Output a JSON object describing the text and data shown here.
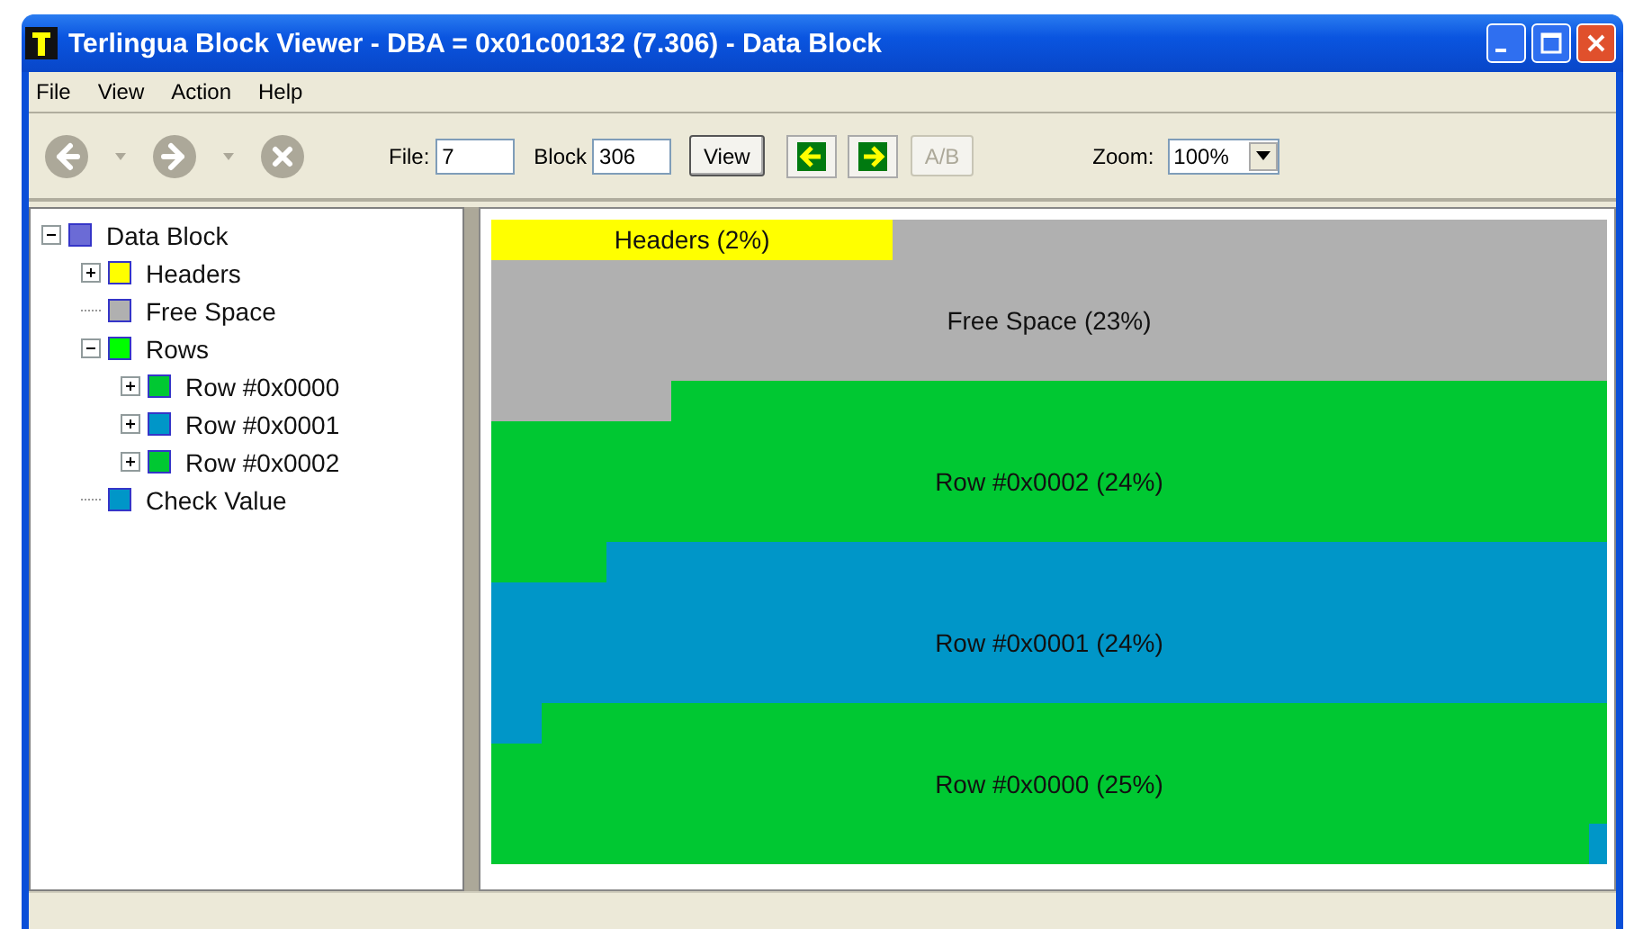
{
  "window": {
    "title": "Terlingua Block Viewer - DBA = 0x01c00132 (7.306) - Data Block"
  },
  "menu": [
    "File",
    "View",
    "Action",
    "Help"
  ],
  "toolbar": {
    "file_label": "File:",
    "file_value": "7",
    "block_label": "Block",
    "block_value": "306",
    "view_button": "View",
    "ab_button": {
      "label": "A/B",
      "disabled": true
    },
    "zoom_label": "Zoom:",
    "zoom_value": "100%"
  },
  "tree": [
    {
      "label": "Data Block",
      "color": "#6b6bd6",
      "expanded": true,
      "children": [
        {
          "label": "Headers",
          "color": "#ffff00",
          "expanded": false
        },
        {
          "label": "Free Space",
          "color": "#b0b0b0"
        },
        {
          "label": "Rows",
          "color": "#00ff00",
          "expanded": true,
          "children": [
            {
              "label": "Row #0x0000",
              "color": "#00c832",
              "expanded": false
            },
            {
              "label": "Row #0x0001",
              "color": "#0096c8",
              "expanded": false
            },
            {
              "label": "Row #0x0002",
              "color": "#00c832",
              "expanded": false
            }
          ]
        },
        {
          "label": "Check Value",
          "color": "#0096c8"
        }
      ]
    }
  ],
  "block_map": [
    {
      "label": "Headers (2%)",
      "color": "#ffff00"
    },
    {
      "label": "Free Space (23%)",
      "color": "#b0b0b0"
    },
    {
      "label": "Row #0x0002 (24%)",
      "color": "#00c832"
    },
    {
      "label": "Row #0x0001 (24%)",
      "color": "#0096c8"
    },
    {
      "label": "Row #0x0000 (25%)",
      "color": "#00c832"
    },
    {
      "color": "#0096c8"
    }
  ]
}
